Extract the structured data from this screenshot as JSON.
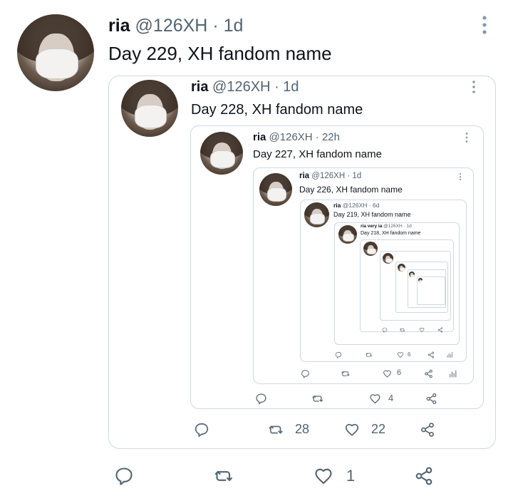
{
  "tweet": {
    "name": "ria",
    "handle": "@126XH",
    "time": "1d",
    "text": "Day 229, XH fandom name",
    "reply_count": "",
    "retweet_count": "",
    "like_count": "1"
  },
  "quote1": {
    "name": "ria",
    "handle": "@126XH",
    "time": "1d",
    "text": "Day 228, XH fandom name",
    "retweet_count": "28",
    "like_count": "22"
  },
  "quote2": {
    "name": "ria",
    "handle": "@126XH",
    "time": "22h",
    "text": "Day 227, XH fandom name",
    "like_count": "4"
  },
  "quote3": {
    "name": "ria",
    "handle": "@126XH",
    "time": "1d",
    "text": "Day 226, XH fandom name",
    "like_count": "6"
  },
  "quote4": {
    "name": "ria",
    "handle": "@126XH",
    "time": "6d",
    "text": "Day 219, XH fandom name",
    "like_count": "6"
  },
  "quote5": {
    "name": "ria very ia",
    "handle": "@126XH",
    "time": "1d",
    "text": "Day 218, XH fandom name"
  },
  "separator": "·",
  "icons": {
    "reply": "reply-icon",
    "retweet": "retweet-icon",
    "like": "heart-icon",
    "share": "share-icon",
    "more": "more-icon",
    "analytics": "analytics-icon"
  }
}
